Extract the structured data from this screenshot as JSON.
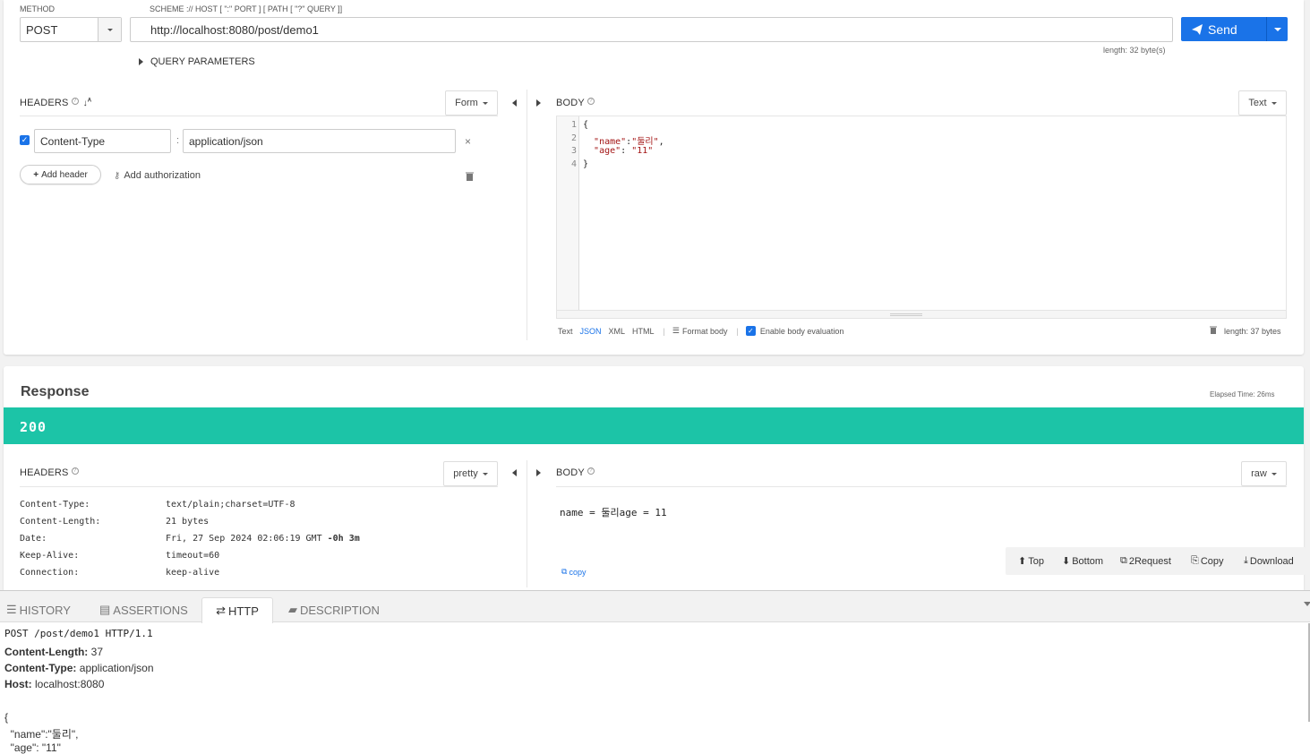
{
  "request": {
    "method_label": "METHOD",
    "method_value": "POST",
    "url_label": "SCHEME :// HOST [ \":\" PORT ] [ PATH [ \"?\" QUERY ]]",
    "url_value": "http://localhost:8080/post/demo1",
    "send_label": "Send",
    "url_length": "length: 32 byte(s)",
    "query_params_label": "QUERY PARAMETERS",
    "headers_label": "HEADERS",
    "headers_mode": "Form",
    "header_rows": [
      {
        "name": "Content-Type",
        "value": "application/json"
      }
    ],
    "add_header_label": "Add header",
    "add_auth_label": "Add authorization",
    "body_label": "BODY",
    "body_mode": "Text",
    "body_lines": [
      {
        "num": "1",
        "text": "{"
      },
      {
        "num": "2",
        "text": "  \"name\":\"둘리\","
      },
      {
        "num": "3",
        "text": "  \"age\": \"11\""
      },
      {
        "num": "4",
        "text": "}"
      }
    ],
    "body_formats": [
      "Text",
      "JSON",
      "XML",
      "HTML"
    ],
    "format_body_label": "Format body",
    "enable_eval_label": "Enable body evaluation",
    "body_length": "length: 37 bytes"
  },
  "response": {
    "title": "Response",
    "elapsed": "Elapsed Time: 26ms",
    "status": "200",
    "headers_label": "HEADERS",
    "headers_mode": "pretty",
    "headers": [
      {
        "key": "Content-Type:",
        "value": "text/plain;charset=UTF-8"
      },
      {
        "key": "Content-Length:",
        "value": "21 bytes"
      },
      {
        "key": "Date:",
        "value": "Fri, 27 Sep 2024 02:06:19 GMT ",
        "extra": "-0h 3m"
      },
      {
        "key": "Keep-Alive:",
        "value": "timeout=60"
      },
      {
        "key": "Connection:",
        "value": "keep-alive"
      }
    ],
    "body_label": "BODY",
    "body_mode": "raw",
    "body_text": "name = 둘리age = 11",
    "copy_label": "copy",
    "toolbar": [
      "Top",
      "Bottom",
      "2Request",
      "Copy",
      "Download"
    ]
  },
  "bottom": {
    "tabs": [
      "HISTORY",
      "ASSERTIONS",
      "HTTP",
      "DESCRIPTION"
    ],
    "request_line": "POST /post/demo1 HTTP/1.1",
    "headers": [
      {
        "key": "Content-Length:",
        "value": " 37"
      },
      {
        "key": "Content-Type:",
        "value": " application/json"
      },
      {
        "key": "Host:",
        "value": " localhost:8080"
      }
    ],
    "body_lines": [
      "{",
      "  \"name\":\"둘리\",",
      "  \"age\": \"11\""
    ]
  },
  "colors": {
    "accent": "#1a73e8",
    "status_ok": "#1cc4a7"
  }
}
